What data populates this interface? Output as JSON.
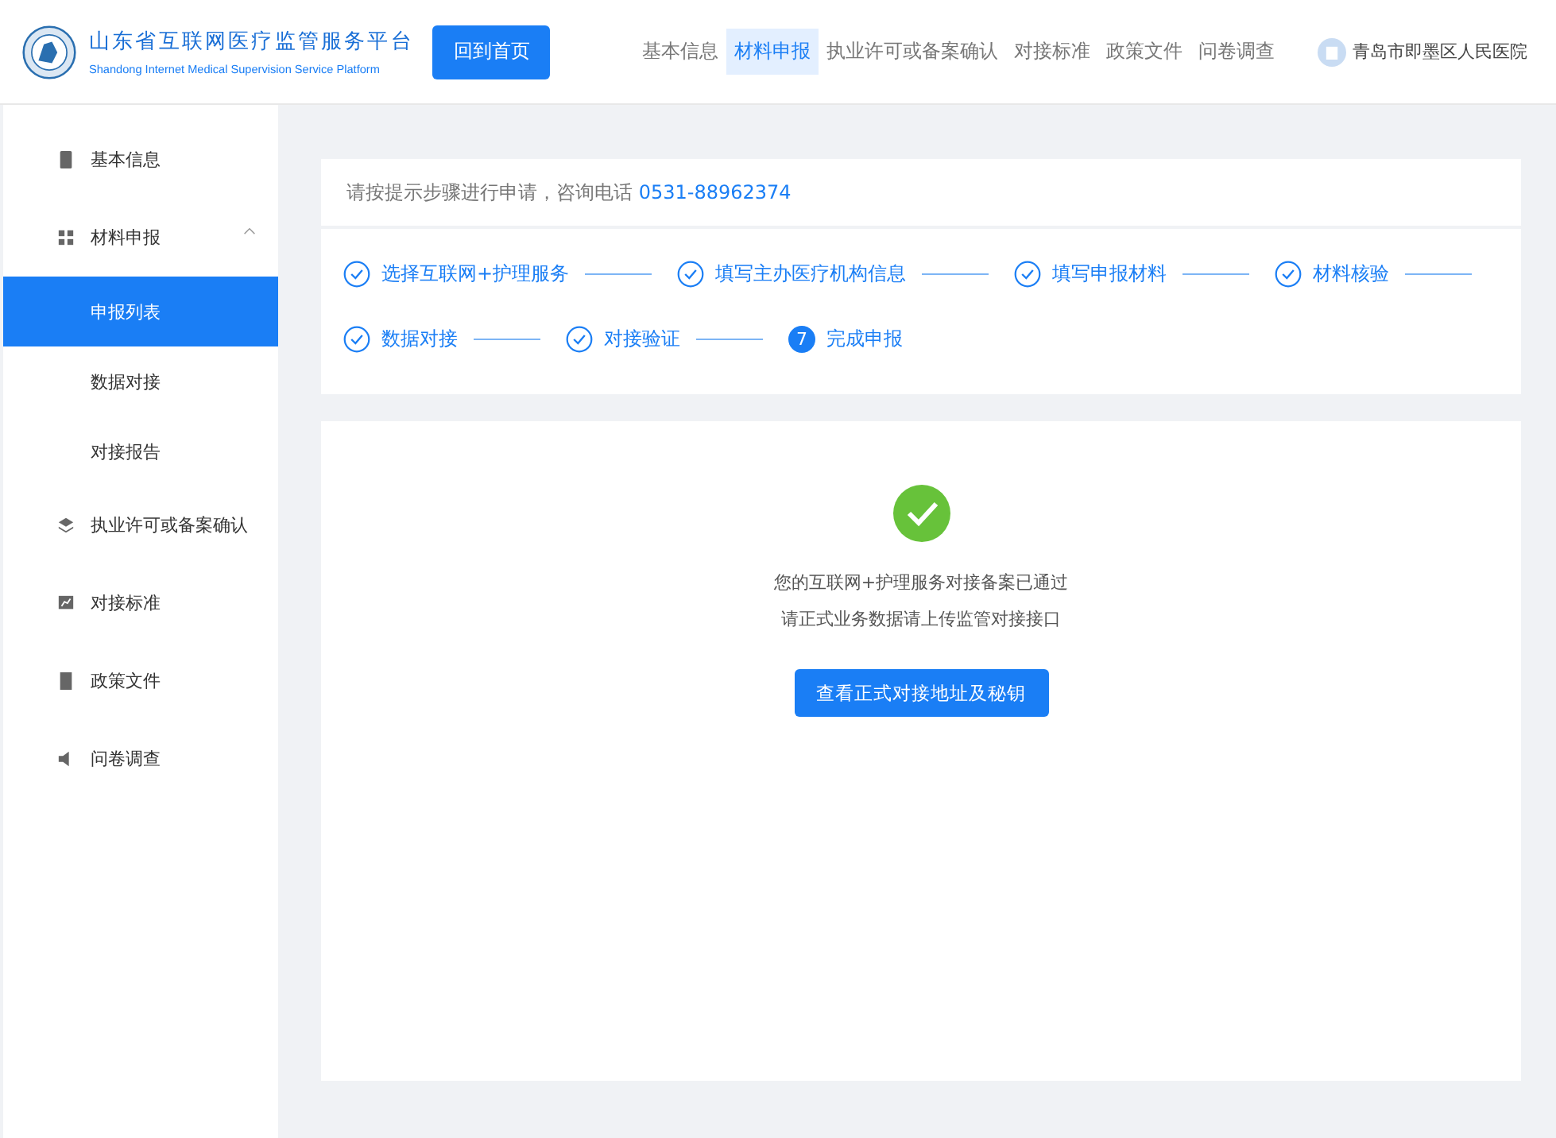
{
  "header": {
    "title": "山东省互联网医疗监管服务平台",
    "subtitle": "Shandong Internet Medical Supervision Service Platform",
    "home_button": "回到首页",
    "nav": [
      {
        "label": "基本信息",
        "selected": false
      },
      {
        "label": "材料申报",
        "selected": true
      },
      {
        "label": "执业许可或备案确认",
        "selected": false
      },
      {
        "label": "对接标准",
        "selected": false
      },
      {
        "label": "政策文件",
        "selected": false
      },
      {
        "label": "问卷调查",
        "selected": false
      }
    ],
    "user": "青岛市即墨区人民医院"
  },
  "sidebar": {
    "items": [
      {
        "label": "基本信息",
        "selected": false
      },
      {
        "label": "材料申报",
        "selected": false,
        "expanded": true,
        "children": [
          {
            "label": "申报列表",
            "selected": true
          },
          {
            "label": "数据对接",
            "selected": false
          },
          {
            "label": "对接报告",
            "selected": false
          }
        ]
      },
      {
        "label": "执业许可或备案确认",
        "selected": false
      },
      {
        "label": "对接标准",
        "selected": false
      },
      {
        "label": "政策文件",
        "selected": false
      },
      {
        "label": "问卷调查",
        "selected": false
      }
    ]
  },
  "notice": {
    "text": "请按提示步骤进行申请，咨询电话",
    "phone": "0531-88962374"
  },
  "steps": [
    {
      "label": "选择互联网+护理服务",
      "kind": "done"
    },
    {
      "label": "填写主办医疗机构信息",
      "kind": "done"
    },
    {
      "label": "填写申报材料",
      "kind": "done"
    },
    {
      "label": "材料核验",
      "kind": "done"
    },
    {
      "label": "数据对接",
      "kind": "done"
    },
    {
      "label": "对接验证",
      "kind": "done"
    },
    {
      "label": "完成申报",
      "kind": "current",
      "number": "7"
    }
  ],
  "result": {
    "lines": [
      "您的互联网+护理服务对接备案已通过",
      "请正式业务数据请上传监管对接接口"
    ],
    "button": "查看正式对接地址及秘钥"
  }
}
